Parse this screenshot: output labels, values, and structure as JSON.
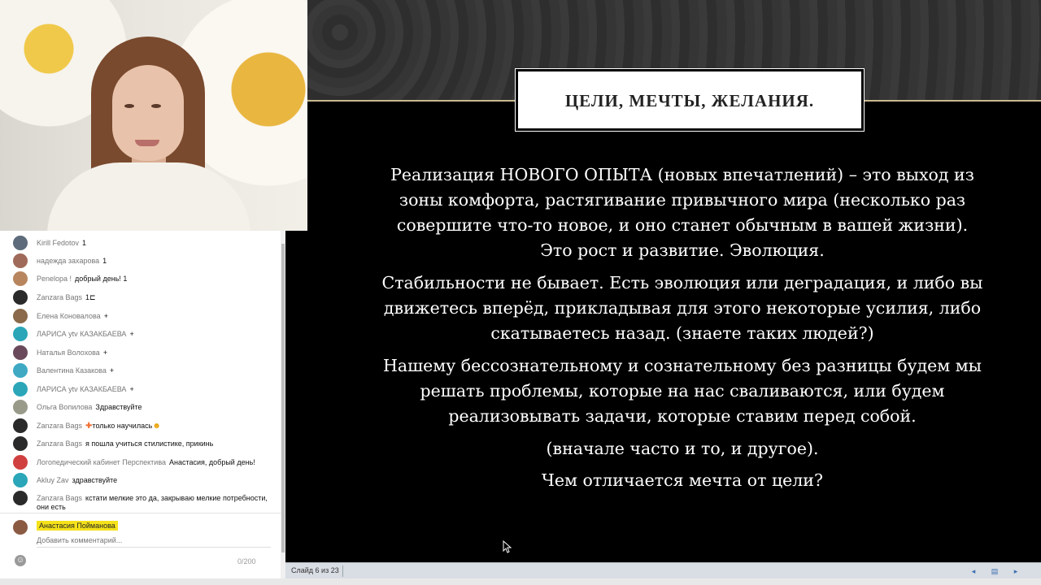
{
  "slide": {
    "title": "ЦЕЛИ, МЕЧТЫ, ЖЕЛАНИЯ.",
    "paragraphs": [
      [
        "Реализация НОВОГО ОПЫТА (новых впечатлений) – это выход из",
        "зоны комфорта, растягивание привычного мира (несколько раз",
        "совершите что-то новое, и оно станет обычным в вашей жизни).",
        "Это рост и развитие. Эволюция."
      ],
      [
        "Стабильности не бывает. Есть эволюция или деградация, и либо вы",
        "движетесь вперёд, прикладывая для этого некоторые усилия, либо",
        "скатываетесь назад. (знаете таких людей?)"
      ],
      [
        "Нашему бессознательному и сознательному без разницы будем мы",
        "решать проблемы, которые на нас сваливаются, или будем",
        "реализовывать задачи, которые ставим перед собой."
      ],
      [
        "(вначале часто и то, и другое)."
      ],
      [
        "Чем отличается мечта от цели?"
      ]
    ]
  },
  "status_bar": {
    "slide_counter": "Слайд 6 из 23"
  },
  "chat": {
    "messages": [
      {
        "author": "Kirill Fedotov",
        "text": "1",
        "avatar_color": "#5d6b7a"
      },
      {
        "author": "надежда захарова",
        "text": "1",
        "avatar_color": "#a06a5a"
      },
      {
        "author": "Penelopa !",
        "text": "добрый день! 1",
        "avatar_color": "#b8865e"
      },
      {
        "author": "Zanzara Bags",
        "text": "1⊏",
        "avatar_color": "#2a2a2a"
      },
      {
        "author": "Елена Коновалова",
        "text": "+",
        "avatar_color": "#8a6a4a"
      },
      {
        "author": "ЛАРИСА ytv КАЗАКБАЕВА",
        "text": "+",
        "avatar_color": "#2aa6b8"
      },
      {
        "author": "Наталья Волохова",
        "text": "+",
        "avatar_color": "#6a4a5a"
      },
      {
        "author": "Валентина Казакова",
        "text": "+",
        "avatar_color": "#3fa9c4"
      },
      {
        "author": "ЛАРИСА ytv КАЗАКБАЕВА",
        "text": "+",
        "avatar_color": "#2aa6b8"
      },
      {
        "author": "Ольга Вопилова",
        "text": "Здравствуйте",
        "avatar_color": "#9a9a8a"
      },
      {
        "author": "Zanzara Bags",
        "text": "только научилась",
        "avatar_color": "#2a2a2a",
        "emoji": true
      },
      {
        "author": "Zanzara Bags",
        "text": "я пошла учиться стилистике, прикинь",
        "avatar_color": "#2a2a2a"
      },
      {
        "author": "Логопедический кабинет Перспектива",
        "text": "Анастасия, добрый день!",
        "avatar_color": "#d04040"
      },
      {
        "author": "Akluy Zav",
        "text": "здравствуйте",
        "avatar_color": "#2aa6b8"
      },
      {
        "author": "Zanzara Bags",
        "text": "кстати мелкие это да, закрываю мелкие потребности, они есть",
        "avatar_color": "#2a2a2a"
      }
    ],
    "current_user": "Анастасия Пойманова",
    "comment_placeholder": "Добавить комментарий...",
    "char_count": "0/200"
  },
  "colors": {
    "slide_bg": "#000000",
    "title_box": "#ffffff",
    "highlight": "#f5e21b",
    "status_bar": "#d9dde4"
  },
  "icons": [
    "smile-icon",
    "prev-slide-icon",
    "notes-icon",
    "next-slide-icon",
    "mouse-cursor-icon"
  ]
}
